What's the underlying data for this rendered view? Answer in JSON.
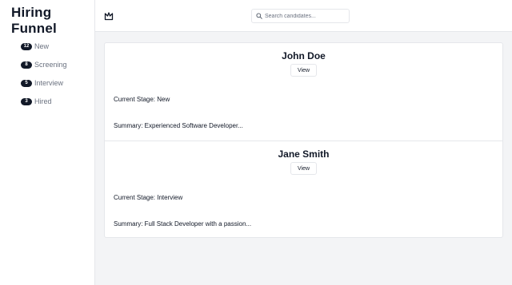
{
  "sidebar": {
    "title": "Hiring Funnel",
    "items": [
      {
        "count": "12",
        "label": "New"
      },
      {
        "count": "8",
        "label": "Screening"
      },
      {
        "count": "5",
        "label": "Interview"
      },
      {
        "count": "3",
        "label": "Hired"
      }
    ]
  },
  "header": {
    "logo_icon": "crown-outline-icon",
    "search": {
      "placeholder": "Search candidates...",
      "value": ""
    }
  },
  "candidates": [
    {
      "name": "John Doe",
      "view_label": "View",
      "stage": "Current Stage: New",
      "summary": "Summary: Experienced Software Developer..."
    },
    {
      "name": "Jane Smith",
      "view_label": "View",
      "stage": "Current Stage: Interview",
      "summary": "Summary: Full Stack Developer with a passion..."
    }
  ],
  "colors": {
    "text": "#111827",
    "muted": "#6b7280",
    "badge": "#111827",
    "background": "#f3f4f6",
    "border": "#e5e7eb"
  }
}
